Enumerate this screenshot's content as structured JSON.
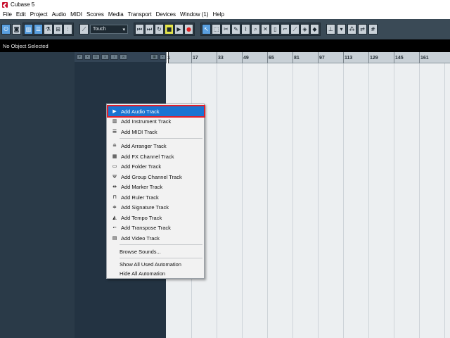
{
  "window": {
    "title": "Cubase 5"
  },
  "menubar": {
    "items": [
      "File",
      "Edit",
      "Project",
      "Audio",
      "MIDI",
      "Scores",
      "Media",
      "Transport",
      "Devices",
      "Window (1)",
      "Help"
    ]
  },
  "toolbar": {
    "automation_mode": "Touch"
  },
  "infoline": {
    "text": "No Object Selected"
  },
  "ruler": {
    "labels": [
      "1",
      "17",
      "33",
      "49",
      "65",
      "81",
      "97",
      "113",
      "129",
      "145",
      "161"
    ]
  },
  "context_menu": {
    "items": [
      {
        "label": "Add Audio Track",
        "icon": "audio-track-icon",
        "glyph": "▶",
        "highlighted": true
      },
      {
        "label": "Add Instrument Track",
        "icon": "instrument-track-icon",
        "glyph": "▥"
      },
      {
        "label": "Add MIDI Track",
        "icon": "midi-track-icon",
        "glyph": "☰"
      },
      {
        "label": "Add Arranger Track",
        "icon": "arranger-track-icon",
        "glyph": "≘"
      },
      {
        "label": "Add FX Channel Track",
        "icon": "fx-channel-track-icon",
        "glyph": "▦"
      },
      {
        "label": "Add Folder Track",
        "icon": "folder-track-icon",
        "glyph": "▭"
      },
      {
        "label": "Add Group Channel Track",
        "icon": "group-channel-track-icon",
        "glyph": "Ψ"
      },
      {
        "label": "Add Marker Track",
        "icon": "marker-track-icon",
        "glyph": "⇹"
      },
      {
        "label": "Add Ruler Track",
        "icon": "ruler-track-icon",
        "glyph": "⊓"
      },
      {
        "label": "Add Signature Track",
        "icon": "signature-track-icon",
        "glyph": "≑"
      },
      {
        "label": "Add Tempo Track",
        "icon": "tempo-track-icon",
        "glyph": "◭"
      },
      {
        "label": "Add Transpose Track",
        "icon": "transpose-track-icon",
        "glyph": "⌐"
      },
      {
        "label": "Add Video Track",
        "icon": "video-track-icon",
        "glyph": "▤"
      },
      {
        "label": "Browse Sounds...",
        "icon": ""
      },
      {
        "label": "Show All Used Automation",
        "icon": ""
      },
      {
        "label": "Hide All Automation",
        "icon": ""
      }
    ]
  },
  "colors": {
    "toolbar_bg": "#3a4a56",
    "inspector_bg": "#2a3a48",
    "tracklist_bg": "#233342",
    "project_bg": "#eceff1",
    "menu_highlight": "#1a74d2",
    "highlight_border": "#e01f2b"
  }
}
